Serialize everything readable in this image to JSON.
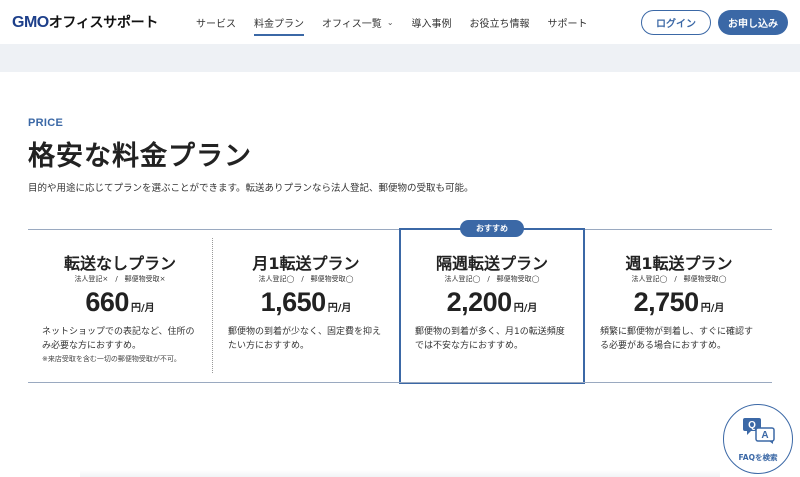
{
  "header": {
    "logo_gmo": "GMO",
    "logo_rest": "オフィスサポート",
    "nav": [
      {
        "label": "サービス"
      },
      {
        "label": "料金プラン",
        "active": true
      },
      {
        "label": "オフィス一覧"
      },
      {
        "label": "導入事例"
      },
      {
        "label": "お役立ち情報"
      },
      {
        "label": "サポート"
      }
    ],
    "login_label": "ログイン",
    "apply_label": "お申し込み"
  },
  "intro": {
    "eyebrow": "PRICE",
    "title": "格安な料金プラン",
    "lead": "目的や用途に応じてプランを選ぶことができます。転送ありプランなら法人登記、郵便物の受取も可能。"
  },
  "plans": [
    {
      "name": "転送なしプラン",
      "feature_registration": "法人登記×",
      "feature_mail": "郵便物受取×",
      "price": "660",
      "unit": "円/月",
      "desc": "ネットショップでの表記など、住所のみ必要な方におすすめ。",
      "note": "※来店受取を含む一切の郵便物受取が不可。"
    },
    {
      "name": "月1転送プラン",
      "feature_registration": "法人登記◯",
      "feature_mail": "郵便物受取◯",
      "price": "1,650",
      "unit": "円/月",
      "desc": "郵便物の到着が少なく、固定費を抑えたい方におすすめ。"
    },
    {
      "name": "隔週転送プラン",
      "feature_registration": "法人登記◯",
      "feature_mail": "郵便物受取◯",
      "price": "2,200",
      "unit": "円/月",
      "desc": "郵便物の到着が多く、月1の転送頻度では不安な方におすすめ。",
      "badge": "おすすめ"
    },
    {
      "name": "週1転送プラン",
      "feature_registration": "法人登記◯",
      "feature_mail": "郵便物受取◯",
      "price": "2,750",
      "unit": "円/月",
      "desc": "頻繁に郵便物が到着し、すぐに確認する必要がある場合におすすめ。"
    }
  ],
  "faq": {
    "q": "Q",
    "a": "A",
    "label": "FAQを検索"
  },
  "colors": {
    "accent": "#3b68a6",
    "band": "#eef1f5"
  }
}
